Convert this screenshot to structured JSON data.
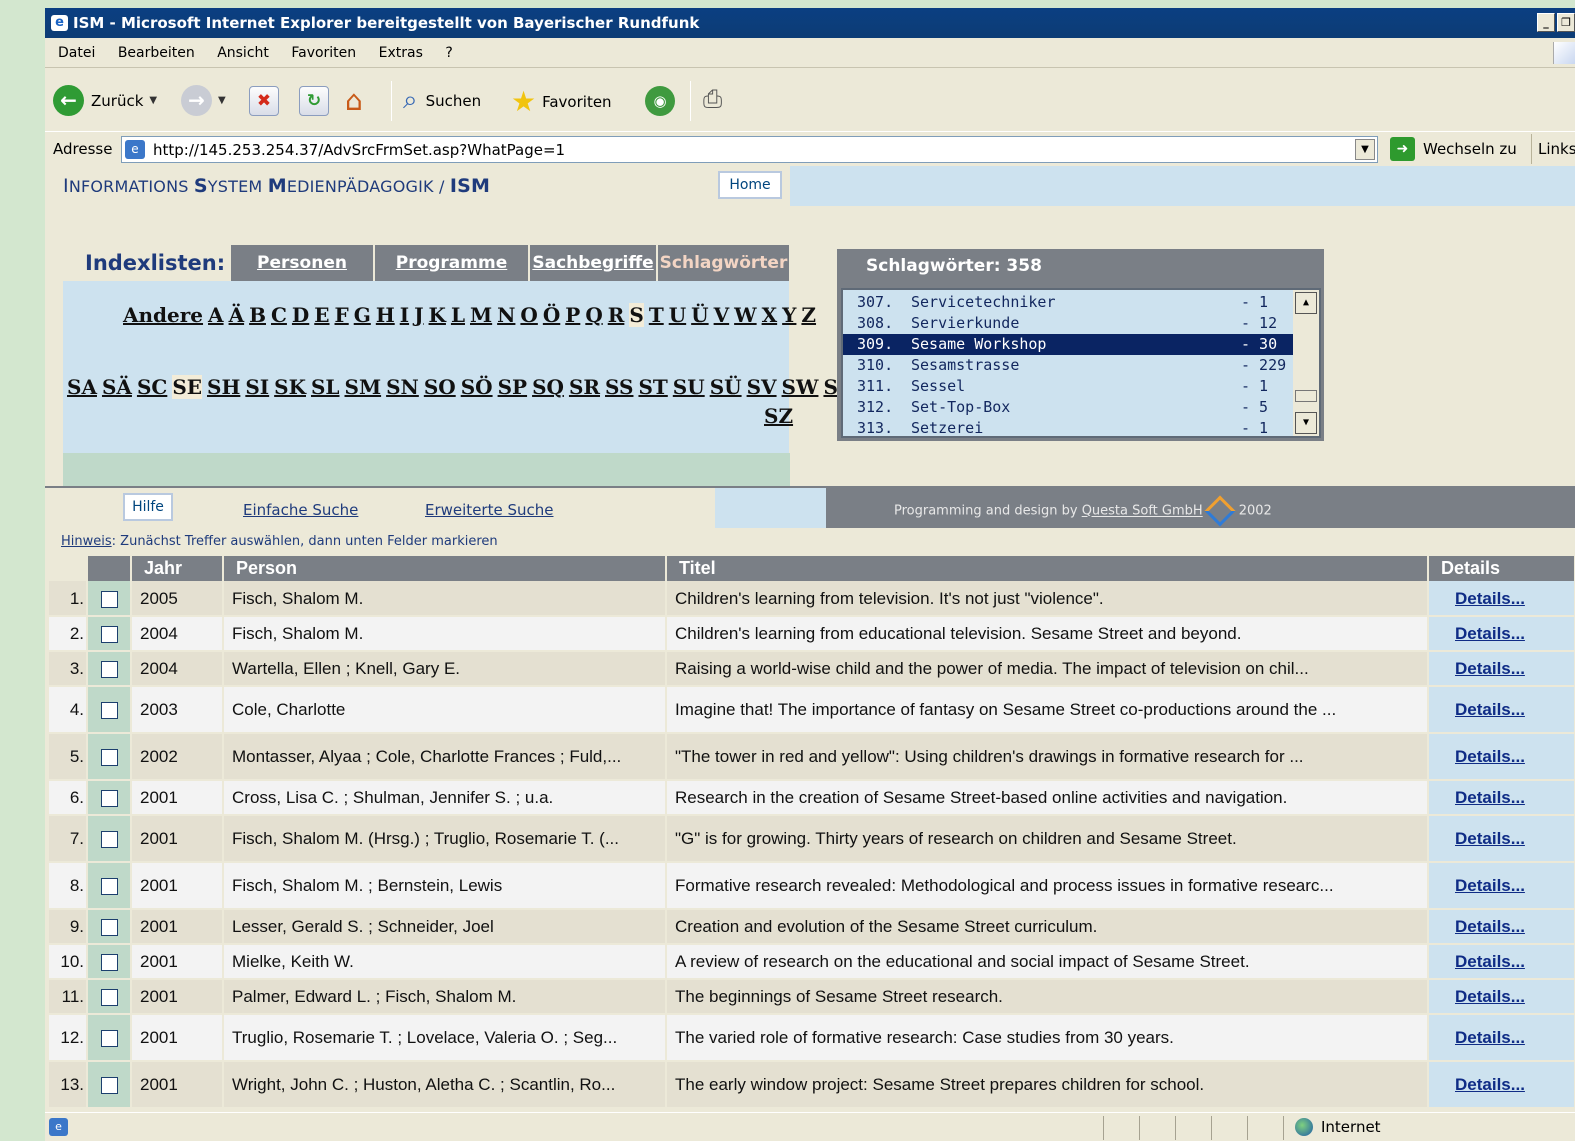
{
  "window": {
    "title": "ISM - Microsoft Internet Explorer bereitgestellt von Bayerischer Rundfunk"
  },
  "menu": [
    "Datei",
    "Bearbeiten",
    "Ansicht",
    "Favoriten",
    "Extras",
    "?"
  ],
  "toolbar": {
    "back_label": "Zurück",
    "search_label": "Suchen",
    "favorites_label": "Favoriten"
  },
  "address": {
    "label": "Adresse",
    "url": "http://145.253.254.37/AdvSrcFrmSet.asp?WhatPage=1",
    "go_label": "Wechseln zu",
    "links_label": "Links"
  },
  "header": {
    "brand_parts": [
      "I",
      "NFORMATIONS ",
      "S",
      "YSTEM ",
      "M",
      "EDIENPÄDAGOGIK / ",
      "ISM"
    ],
    "home_label": "Home"
  },
  "indexlisten": {
    "label": "Indexlisten:",
    "tabs": [
      "Personen",
      "Programme",
      "Sachbegriffe",
      "Schlagwörter"
    ],
    "active_tab": "Schlagwörter",
    "letters": [
      "Andere",
      "A",
      "Ä",
      "B",
      "C",
      "D",
      "E",
      "F",
      "G",
      "H",
      "I",
      "J",
      "K",
      "L",
      "M",
      "N",
      "O",
      "Ö",
      "P",
      "Q",
      "R",
      "S",
      "T",
      "U",
      "Ü",
      "V",
      "W",
      "X",
      "Y",
      "Z"
    ],
    "current_letter": "S",
    "sublist": [
      "SA",
      "SÄ",
      "SC",
      "SE",
      "SH",
      "SI",
      "SK",
      "SL",
      "SM",
      "SN",
      "SO",
      "SÖ",
      "SP",
      "SQ",
      "SR",
      "SS",
      "ST",
      "SU",
      "SÜ",
      "SV",
      "SW",
      "SY"
    ],
    "sublist_last": "SZ",
    "current_sub": "SE"
  },
  "schlagwoerter": {
    "title": "Schlagwörter: 358",
    "items": [
      {
        "num": "307.",
        "word": "Servicetechniker",
        "count": "- 1"
      },
      {
        "num": "308.",
        "word": "Servierkunde",
        "count": "- 12"
      },
      {
        "num": "309.",
        "word": "Sesame Workshop",
        "count": "- 30",
        "selected": true
      },
      {
        "num": "310.",
        "word": "Sesamstrasse",
        "count": "- 229"
      },
      {
        "num": "311.",
        "word": "Sessel",
        "count": "- 1"
      },
      {
        "num": "312.",
        "word": "Set-Top-Box",
        "count": "- 5"
      },
      {
        "num": "313.",
        "word": "Setzerei",
        "count": "- 1"
      }
    ]
  },
  "bar2": {
    "hilfe_label": "Hilfe",
    "einfache_label": "Einfache Suche",
    "erweiterte_label": "Erweiterte Suche",
    "credits_prefix": "Programming and design by ",
    "credits_company": "Questa Soft GmbH",
    "credits_year": "2002"
  },
  "hinweis": {
    "label": "Hinweis",
    "text": ": Zunächst Treffer auswählen, dann unten Felder markieren"
  },
  "table": {
    "headers": [
      "",
      "Jahr",
      "Person",
      "Titel",
      "Details"
    ],
    "details_label": "Details...",
    "rows": [
      {
        "num": "1.",
        "jahr": "2005",
        "person": "Fisch, Shalom M.",
        "titel": "Children's learning from television. It's not just \"violence\"."
      },
      {
        "num": "2.",
        "jahr": "2004",
        "person": "Fisch, Shalom M.",
        "titel": "Children's learning from educational television. Sesame Street and beyond."
      },
      {
        "num": "3.",
        "jahr": "2004",
        "person": "Wartella, Ellen ; Knell, Gary E.",
        "titel": "Raising a world-wise child and the power of media. The impact of television on chil..."
      },
      {
        "num": "4.",
        "jahr": "2003",
        "person": "Cole, Charlotte",
        "titel": "Imagine that! The importance of fantasy on Sesame Street co-productions around the ..."
      },
      {
        "num": "5.",
        "jahr": "2002",
        "person": "Montasser, Alyaa ; Cole, Charlotte Frances ; Fuld,...",
        "titel": "\"The tower in red and yellow\": Using children's drawings in formative research for ..."
      },
      {
        "num": "6.",
        "jahr": "2001",
        "person": "Cross, Lisa C. ; Shulman, Jennifer S. ; u.a.",
        "titel": "Research in the creation of Sesame Street-based online activities and navigation."
      },
      {
        "num": "7.",
        "jahr": "2001",
        "person": "Fisch, Shalom M. (Hrsg.) ; Truglio, Rosemarie T. (...",
        "titel": "\"G\" is for growing. Thirty years of research on children and Sesame Street."
      },
      {
        "num": "8.",
        "jahr": "2001",
        "person": "Fisch, Shalom M. ; Bernstein, Lewis",
        "titel": "Formative research revealed: Methodological and process issues in formative researc..."
      },
      {
        "num": "9.",
        "jahr": "2001",
        "person": "Lesser, Gerald S. ; Schneider, Joel",
        "titel": "Creation and evolution of the Sesame Street curriculum."
      },
      {
        "num": "10.",
        "jahr": "2001",
        "person": "Mielke, Keith W.",
        "titel": "A review of research on the educational and social impact of Sesame Street."
      },
      {
        "num": "11.",
        "jahr": "2001",
        "person": "Palmer, Edward L. ; Fisch, Shalom M.",
        "titel": "The beginnings of Sesame Street research."
      },
      {
        "num": "12.",
        "jahr": "2001",
        "person": "Truglio, Rosemarie T. ; Lovelace, Valeria O. ; Seg...",
        "titel": "The varied role of formative research: Case studies from 30 years."
      },
      {
        "num": "13.",
        "jahr": "2001",
        "person": "Wright, John C. ; Huston, Aletha C. ; Scantlin, Ro...",
        "titel": "The early window project: Sesame Street prepares children for school."
      }
    ]
  },
  "status": {
    "zone": "Internet"
  }
}
